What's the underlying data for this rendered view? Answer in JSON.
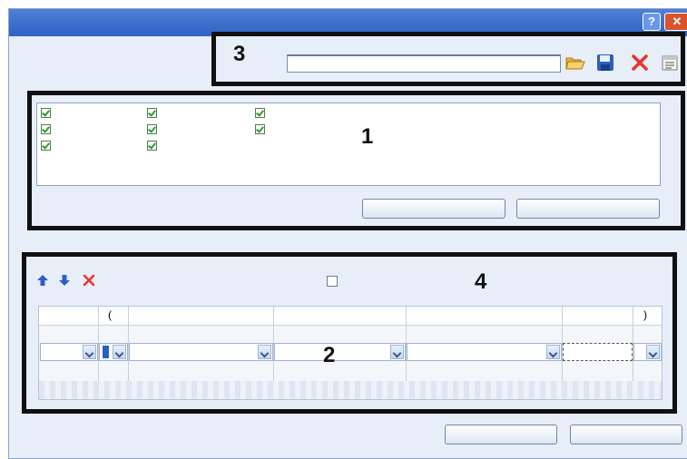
{
  "window": {
    "title": "",
    "help_glyph": "?",
    "close_glyph": "✕"
  },
  "markers": {
    "m1": "1",
    "m2": "2",
    "m3": "3",
    "m4": "4"
  },
  "toolbar": {
    "path_value": "",
    "icons": [
      "open-folder-icon",
      "save-icon",
      "delete-icon",
      "properties-icon"
    ]
  },
  "checklist": {
    "items": [
      {
        "label": "",
        "checked": true
      },
      {
        "label": "",
        "checked": true
      },
      {
        "label": "",
        "checked": true
      },
      {
        "label": "",
        "checked": true
      },
      {
        "label": "",
        "checked": true
      },
      {
        "label": "",
        "checked": true
      },
      {
        "label": "",
        "checked": true
      },
      {
        "label": "",
        "checked": true
      }
    ],
    "button_left_label": "",
    "button_right_label": ""
  },
  "grid": {
    "toolbar_icons": [
      "move-up-icon",
      "move-down-icon",
      "delete-row-icon"
    ],
    "headers": [
      "",
      "(",
      "",
      "",
      "",
      "",
      ")"
    ],
    "option_checkbox_checked": false
  },
  "footer": {
    "ok_label": "",
    "cancel_label": ""
  },
  "colors": {
    "accent": "#2f63c4",
    "check_green": "#2f9a2f",
    "delete_red": "#e8322b",
    "arrow_blue": "#2a5fc4"
  }
}
